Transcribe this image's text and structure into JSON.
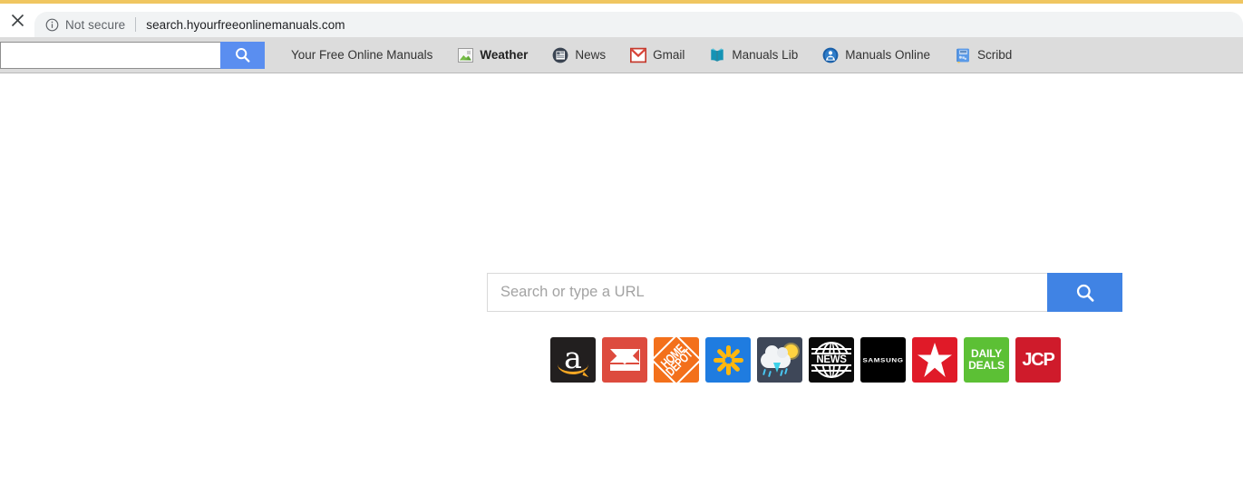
{
  "browser": {
    "top_accent_color": "#f0c660",
    "close_tab_icon": "close-icon",
    "security_icon": "info-circle-icon",
    "security_label": "Not secure",
    "url": "search.hyourfreeonlinemanuals.com"
  },
  "toolbar": {
    "search_value": "",
    "search_placeholder": "",
    "search_button_icon": "search-icon",
    "search_button_color": "#5a8ef0",
    "bookmarks": [
      {
        "label": "Your Free Online Manuals",
        "icon": "none",
        "bold": false
      },
      {
        "label": "Weather",
        "icon": "broken-image-icon",
        "bold": true
      },
      {
        "label": "News",
        "icon": "newspaper-circle-icon",
        "bold": false
      },
      {
        "label": "Gmail",
        "icon": "gmail-envelope-icon",
        "bold": false
      },
      {
        "label": "Manuals Lib",
        "icon": "open-book-icon",
        "bold": false
      },
      {
        "label": "Manuals Online",
        "icon": "person-reading-icon",
        "bold": false
      },
      {
        "label": "Scribd",
        "icon": "scribd-book-icon",
        "bold": false
      }
    ]
  },
  "main": {
    "search_value": "",
    "search_placeholder": "Search or type a URL",
    "search_button_icon": "search-icon",
    "search_button_color": "#4083e4",
    "tiles": [
      {
        "name": "amazon",
        "label": "",
        "bg": "#221f1f"
      },
      {
        "name": "gmail",
        "label": "",
        "bg": "#dd4b3e"
      },
      {
        "name": "home-depot",
        "label": "HOME DEPOT",
        "bg": "#f3701b"
      },
      {
        "name": "walmart",
        "label": "",
        "bg": "#1f7ce0"
      },
      {
        "name": "weather",
        "label": "",
        "bg": "#3e4758"
      },
      {
        "name": "news",
        "label": "NEWS",
        "bg": "#0a0a0a"
      },
      {
        "name": "samsung",
        "label": "SAMSUNG",
        "bg": "#000000"
      },
      {
        "name": "macys",
        "label": "",
        "bg": "#e01a28"
      },
      {
        "name": "daily-deals",
        "label": "DAILY DEALS",
        "bg": "#5cc035"
      },
      {
        "name": "jcp",
        "label": "JCP",
        "bg": "#cf1b2b"
      }
    ],
    "tile_text": {
      "home_depot_line1": "HOME",
      "home_depot_line2": "DEPOT",
      "news": "NEWS",
      "samsung": "SAMSUNG",
      "daily_line1": "DAILY",
      "daily_line2": "DEALS",
      "jcp": "JCP"
    }
  }
}
